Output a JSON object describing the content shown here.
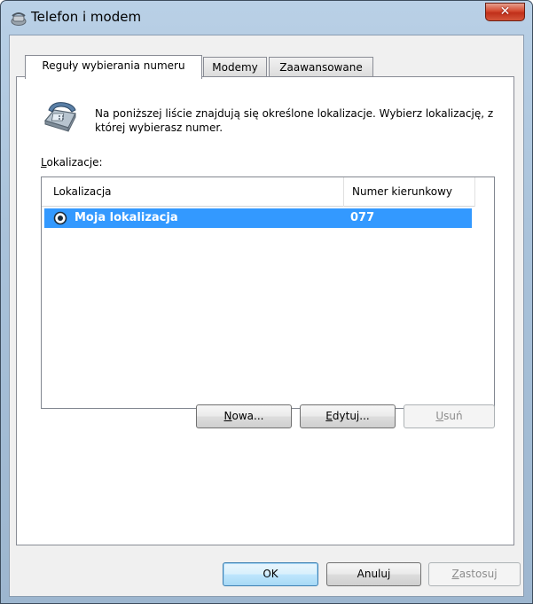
{
  "window": {
    "title": "Telefon i modem",
    "close_symbol": "✕",
    "icon": "phone-modem-icon"
  },
  "tabs": [
    {
      "label": "Reguły wybierania numeru",
      "active": true
    },
    {
      "label": "Modemy",
      "active": false
    },
    {
      "label": "Zaawansowane",
      "active": false
    }
  ],
  "panel": {
    "description": "Na poniższej liście znajdują się określone lokalizacje. Wybierz lokalizację, z której wybierasz numer.",
    "locations_label_first": "L",
    "locations_label_rest": "okalizacje:",
    "icon": "telephone-icon"
  },
  "list": {
    "columns": [
      "Lokalizacja",
      "Numer kierunkowy"
    ],
    "rows": [
      {
        "name": "Moja lokalizacja",
        "area_code": "077",
        "selected": true
      }
    ]
  },
  "list_buttons": {
    "new_first": "N",
    "new_rest": "owa...",
    "edit_first": "E",
    "edit_rest": "dytuj...",
    "delete_first": "U",
    "delete_rest": "suń"
  },
  "dialog_buttons": {
    "ok": "OK",
    "cancel": "Anuluj",
    "apply_first": "Z",
    "apply_rest": "astosuj"
  },
  "colors": {
    "selection": "#3399ff",
    "close_button": "#c0301a"
  }
}
